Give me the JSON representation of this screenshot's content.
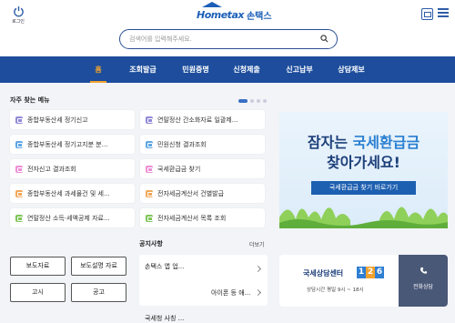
{
  "header": {
    "login_label": "로그인",
    "logo_text": "Hometax",
    "logo_kr": "손택스"
  },
  "search": {
    "placeholder": "검색어를 입력해주세요."
  },
  "nav": {
    "tabs": [
      "홈",
      "조회발급",
      "민원증명",
      "신청제출",
      "신고납부",
      "상담제보"
    ]
  },
  "quick_menu": {
    "title": "자주 찾는 메뉴",
    "items": [
      {
        "label": "종합부동산세 정기신고",
        "color": "#8f8ad8"
      },
      {
        "label": "연말정산 간소화자료 일괄제...",
        "color": "#8f8ad8"
      },
      {
        "label": "종합부동산세 정기고지분 분...",
        "color": "#5ea6e4"
      },
      {
        "label": "민원신청 결과조회",
        "color": "#5ea6e4"
      },
      {
        "label": "전자신고 결과조회",
        "color": "#ec8fd6"
      },
      {
        "label": "국세환급금 찾기",
        "color": "#ec8fd6"
      },
      {
        "label": "종합부동산세 과세물건 및 세...",
        "color": "#f2a85a"
      },
      {
        "label": "전자세금계산서 건별발급",
        "color": "#f2a85a"
      },
      {
        "label": "연말정산 소득·세액공제 자료...",
        "color": "#7fc659"
      },
      {
        "label": "전자세금계산서 목록 조회",
        "color": "#7fc659"
      }
    ]
  },
  "banner": {
    "line1_a": "잠자는 ",
    "line1_b": "국세환급금",
    "line2": "찾아가세요!",
    "cta": "국세환급금 찾기 바로가기"
  },
  "side_buttons": [
    "보도자료",
    "보도설명 자료",
    "고시",
    "공고"
  ],
  "notice": {
    "title": "공지사항",
    "more": "더보기",
    "item1": "손택스 앱 업...",
    "item2": "아이폰 등 애...",
    "item3": "국세청 사칭 ..."
  },
  "call_center": {
    "title": "국세상담센터",
    "number": [
      "1",
      "2",
      "6"
    ],
    "number_colors": [
      "#2f7fd3",
      "#f0a22e",
      "#2f7fd3"
    ],
    "hours": "상담시간 평일 9시 ~ 18시",
    "phone_label": "전화상담"
  },
  "colors": {
    "nav_bg": "#1d4d9c",
    "accent": "#f0a22e",
    "brand": "#1b5fb8"
  }
}
